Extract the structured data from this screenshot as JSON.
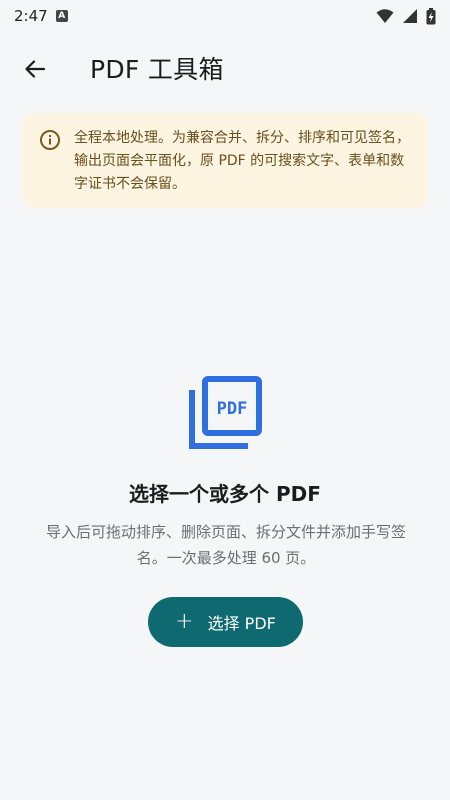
{
  "status_bar": {
    "time": "2:47",
    "notif_glyph": "A"
  },
  "app_bar": {
    "title": "PDF 工具箱",
    "back_icon": "arrow-left-icon"
  },
  "notice": {
    "icon": "info-icon",
    "text": "全程本地处理。为兼容合并、拆分、排序和可见签名，输出页面会平面化，原 PDF 的可搜索文字、表单和数字证书不会保留。"
  },
  "empty_state": {
    "icon": "pdf-icon",
    "icon_glyph_text": "PDF",
    "title": "选择一个或多个 PDF",
    "description": "导入后可拖动排序、删除页面、拆分文件并添加手写签名。一次最多处理 60 页。"
  },
  "primary_action": {
    "plus": "+",
    "label": "选择 PDF"
  },
  "colors": {
    "accent": "#0e6970",
    "notice_bg": "#fdf4e2",
    "notice_text": "#6b4f1c",
    "pdf_icon": "#2f6fe0"
  }
}
